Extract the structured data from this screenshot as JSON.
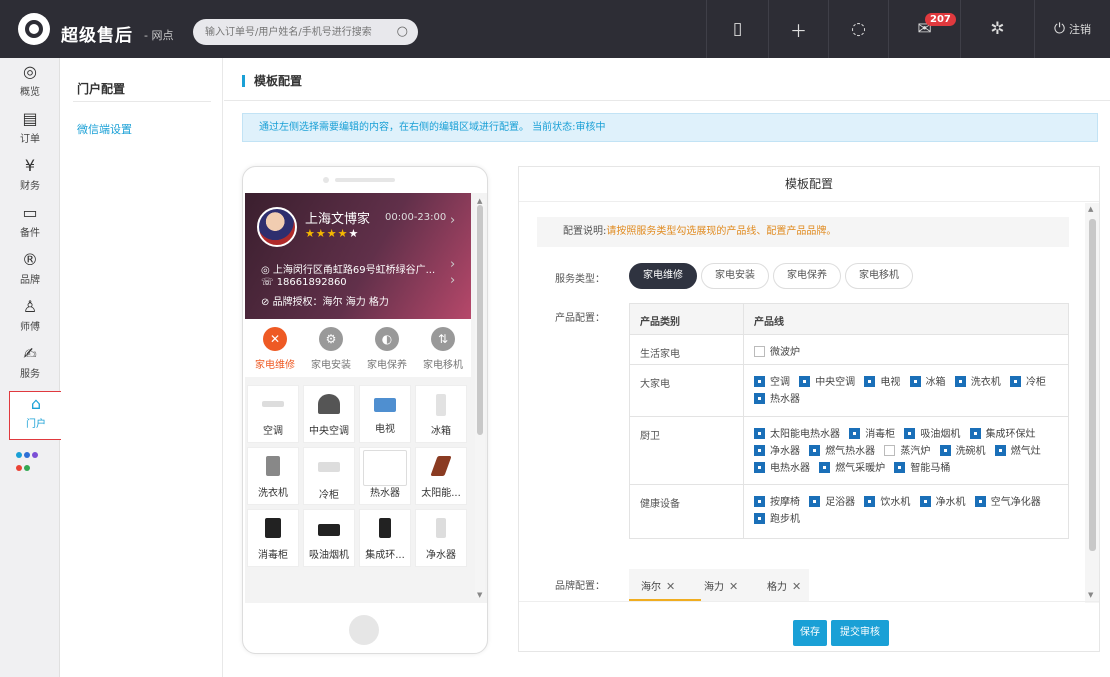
{
  "topbar": {
    "brand": "超级售后",
    "brand_sub": "- 网点",
    "search_placeholder": "输入订单号/用户姓名/手机号进行搜索",
    "mail_badge": "207",
    "logout": "注销",
    "icons": [
      "tablet-icon",
      "plus-icon",
      "chat-icon",
      "mail-icon",
      "gear-icon",
      "power-icon"
    ]
  },
  "sidebar": {
    "items": [
      {
        "label": "概览",
        "icon": "overview-icon",
        "glyph": "◎"
      },
      {
        "label": "订单",
        "icon": "order-icon",
        "glyph": "▤"
      },
      {
        "label": "财务",
        "icon": "finance-icon",
        "glyph": "¥"
      },
      {
        "label": "备件",
        "icon": "parts-icon",
        "glyph": "▭"
      },
      {
        "label": "品牌",
        "icon": "brand-icon",
        "glyph": "®"
      },
      {
        "label": "师傅",
        "icon": "master-icon",
        "glyph": "♙"
      },
      {
        "label": "服务",
        "icon": "service-icon",
        "glyph": "✍"
      },
      {
        "label": "门户",
        "icon": "home-icon",
        "glyph": "⌂"
      }
    ],
    "active": "门户",
    "dot_colors": [
      "#1aa0d6",
      "#2d6fd6",
      "#7c4fd6",
      "#ea4335",
      "#34a853"
    ]
  },
  "subnav": {
    "header": "门户配置",
    "item": "微信端设置"
  },
  "main": {
    "title": "模板配置",
    "notice": "通过左侧选择需要编辑的内容，在右侧的编辑区域进行配置。 当前状态:审核中"
  },
  "phone": {
    "shop_name": "上海文博家",
    "hours": "00:00-23:00",
    "stars_filled": "★★★★",
    "stars_empty": "★",
    "address": "上海闵行区甬虹路69号虹桥绿谷广...",
    "phone": "18661892860",
    "brands": "品牌授权：海尔 海力 格力",
    "services": [
      {
        "label": "家电维修",
        "icon": "repair-icon",
        "glyph": "✕"
      },
      {
        "label": "家电安装",
        "icon": "install-icon",
        "glyph": "⚙"
      },
      {
        "label": "家电保养",
        "icon": "maintain-icon",
        "glyph": "◐"
      },
      {
        "label": "家电移机",
        "icon": "move-icon",
        "glyph": "⇅"
      }
    ],
    "products": [
      "空调",
      "中央空调",
      "电视",
      "冰箱",
      "洗衣机",
      "冷柜",
      "热水器",
      "太阳能...",
      "消毒柜",
      "吸油烟机",
      "集成环...",
      "净水器"
    ]
  },
  "panel": {
    "header": "模板配置",
    "help_key": "配置说明:",
    "help_value": "请按照服务类型勾选展现的产品线、配置产品品牌。",
    "service_type_label": "服务类型：",
    "service_types": [
      "家电维修",
      "家电安装",
      "家电保养",
      "家电移机"
    ],
    "product_config_label": "产品配置：",
    "col_category": "产品类别",
    "col_line": "产品线",
    "rows": [
      {
        "category": "生活家电",
        "lines": [
          {
            "name": "微波炉",
            "checked": false
          }
        ]
      },
      {
        "category": "大家电",
        "lines": [
          {
            "name": "空调",
            "checked": true
          },
          {
            "name": "中央空调",
            "checked": true
          },
          {
            "name": "电视",
            "checked": true
          },
          {
            "name": "冰箱",
            "checked": true
          },
          {
            "name": "洗衣机",
            "checked": true
          },
          {
            "name": "冷柜",
            "checked": true
          },
          {
            "name": "热水器",
            "checked": true
          }
        ]
      },
      {
        "category": "厨卫",
        "lines": [
          {
            "name": "太阳能电热水器",
            "checked": true
          },
          {
            "name": "消毒柜",
            "checked": true
          },
          {
            "name": "吸油烟机",
            "checked": true
          },
          {
            "name": "集成环保灶",
            "checked": true
          },
          {
            "name": "净水器",
            "checked": true
          },
          {
            "name": "燃气热水器",
            "checked": true
          },
          {
            "name": "蒸汽炉",
            "checked": false
          },
          {
            "name": "洗碗机",
            "checked": true
          },
          {
            "name": "燃气灶",
            "checked": true
          },
          {
            "name": "电热水器",
            "checked": true
          },
          {
            "name": "燃气采暖炉",
            "checked": true
          },
          {
            "name": "智能马桶",
            "checked": true
          }
        ]
      },
      {
        "category": "健康设备",
        "lines": [
          {
            "name": "按摩椅",
            "checked": true
          },
          {
            "name": "足浴器",
            "checked": true
          },
          {
            "name": "饮水机",
            "checked": true
          },
          {
            "name": "净水机",
            "checked": true
          },
          {
            "name": "空气净化器",
            "checked": true
          },
          {
            "name": "跑步机",
            "checked": true
          }
        ]
      }
    ],
    "brand_config_label": "品牌配置：",
    "brands": [
      "海尔",
      "海力",
      "格力"
    ],
    "save": "保存",
    "submit": "提交审核"
  }
}
